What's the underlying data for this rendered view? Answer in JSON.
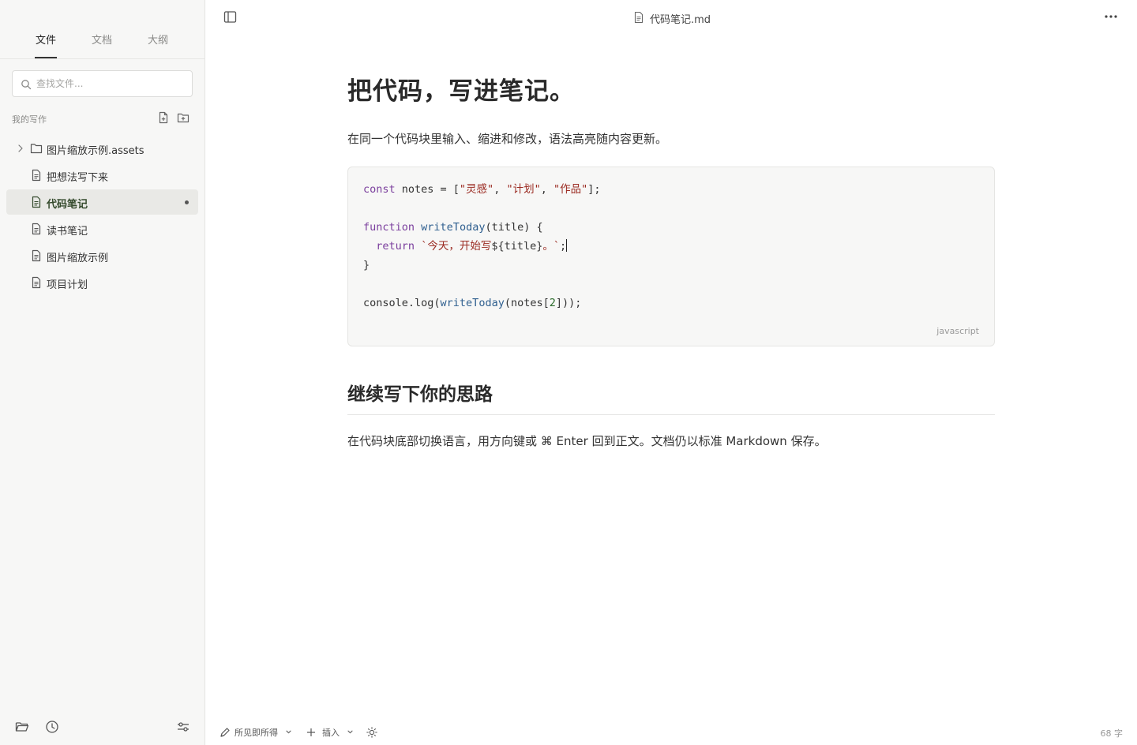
{
  "sidebar": {
    "tabs": [
      {
        "label": "文件",
        "active": true
      },
      {
        "label": "文档",
        "active": false
      },
      {
        "label": "大纲",
        "active": false
      }
    ],
    "search_placeholder": "查找文件...",
    "section_label": "我的写作",
    "tree": [
      {
        "label": "图片缩放示例.assets",
        "type": "folder",
        "active": false
      },
      {
        "label": "把想法写下来",
        "type": "file",
        "active": false
      },
      {
        "label": "代码笔记",
        "type": "file",
        "active": true,
        "unsaved": true
      },
      {
        "label": "读书笔记",
        "type": "file",
        "active": false
      },
      {
        "label": "图片缩放示例",
        "type": "file",
        "active": false
      },
      {
        "label": "项目计划",
        "type": "file",
        "active": false
      }
    ],
    "footer_icons": [
      "folder-open-icon",
      "history-icon",
      "settings-sliders-icon"
    ]
  },
  "topbar": {
    "file_name": "代码笔记.md"
  },
  "document": {
    "title": "把代码，写进笔记。",
    "intro": "在同一个代码块里输入、缩进和修改，语法高亮随内容更新。",
    "code_language": "javascript",
    "heading2": "继续写下你的思路",
    "paragraph2": "在代码块底部切换语言，用方向键或 ⌘ Enter 回到正文。文档仍以标准 Markdown 保存。"
  },
  "statusbar": {
    "mode_label": "所见即所得",
    "insert_label": "插入",
    "word_count": "68 字"
  },
  "colors": {
    "sidebar_bg": "#f7f7f6",
    "active_item_text": "#344a2c",
    "code_keyword": "#7a3e9d",
    "code_string": "#9b2b22",
    "code_function": "#2f5f8f"
  }
}
